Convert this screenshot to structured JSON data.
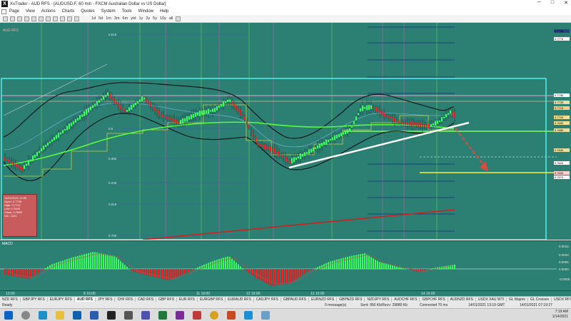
{
  "window": {
    "app_letter": "X",
    "title": "XsTrader - AUD RFS - [AUDUSD,F, 60 min - FXCM Australian Dollar vs US Dollar]",
    "minimize": "─",
    "maximize": "□",
    "close": "✕"
  },
  "menu": {
    "items": [
      "Page",
      "View",
      "Actions",
      "Charts",
      "Quotes",
      "System",
      "Tools",
      "Window",
      "Help"
    ]
  },
  "toolbar": {
    "items": [
      "1d",
      "5d",
      "1m",
      "3m",
      "6m",
      "ytd",
      "1y",
      "2y",
      "5y",
      "10y",
      "all"
    ]
  },
  "chart": {
    "top_label": "AUD RFS",
    "price_labels": [
      {
        "text": "0.7795",
        "color": "#2b3f8a"
      },
      {
        "text": "0.7776",
        "color": "#ffffff"
      },
      {
        "text": "0.7750",
        "color": "#ffffff"
      },
      {
        "text": "0.7735",
        "color": "#e8e0a0"
      },
      {
        "text": "0.7715",
        "color": "#ffd080"
      },
      {
        "text": "0.7700",
        "color": "#f0e090"
      },
      {
        "text": "0.7690",
        "color": "#f0e090"
      },
      {
        "text": "0.7680",
        "color": "#e8e0a0"
      },
      {
        "text": "0.7640",
        "color": "#e8e0a0"
      },
      {
        "text": "0.7620",
        "color": "#ffffff"
      },
      {
        "text": "0.7600",
        "color": "#ffd0d0"
      },
      {
        "text": "0.7570",
        "color": "#ffffff"
      }
    ],
    "fib_labels": [
      "0.618",
      "0.5",
      "0.382",
      "0.236",
      "0.618",
      "0.786"
    ],
    "infobox": {
      "date": "14/01/2021 12:00",
      "open": "Open: 0.7705",
      "high": "High: 0.7712",
      "low": "Low: 0.7693",
      "close": "Close: 0.7699",
      "vol": "Vol.: 1121"
    }
  },
  "macd": {
    "label": "MACD",
    "axis_labels": [
      "0.0015",
      "0.0010",
      "0.0005",
      "0.0000",
      "-0.0005"
    ]
  },
  "time_axis": {
    "labels": [
      "13:00",
      "8 16:00",
      "11 16:00",
      "12 16:00",
      "13 16:00",
      "14 16:00"
    ]
  },
  "tabs": {
    "items": [
      "NZD RFS",
      "GBPJPY RFS",
      "EURJPY RFS",
      "AUD RFS",
      "JPY RFS",
      "CHF RFS",
      "CAD RFS",
      "GBP RFS",
      "EUR RFS",
      "EURGBP RFS",
      "EURAUD RFS",
      "CADJPY RFS",
      "GBPAUD RFS",
      "EURNZD RFS",
      "GBPNZD RFS",
      "NZDJPY RFS",
      "AUDCHF RFS",
      "GBPCHF RFS",
      "AUDNZD RFS",
      "USDX XAU WTI",
      "GL Majors",
      "GL Crosses",
      "USDX RFS"
    ],
    "active_index": 3
  },
  "status": {
    "ready": "Ready",
    "messages": "0 message(s)",
    "traffic": "Sent: 950 Kb/Recv: 29880 Kb",
    "time1": "14/01/2021 13:19 GMT",
    "time2": "14/01/2021 07:19:27",
    "latency": "Connected 70 ms"
  },
  "taskbar": {
    "time": "7:19 AM",
    "date": "1/14/2021"
  }
}
